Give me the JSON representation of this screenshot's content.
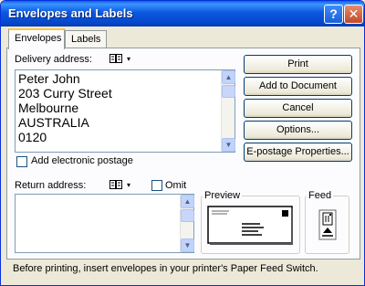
{
  "window": {
    "title": "Envelopes and Labels",
    "help_glyph": "?",
    "close_glyph": "✕"
  },
  "tabs": [
    {
      "label": "Envelopes",
      "active": true
    },
    {
      "label": "Labels",
      "active": false
    }
  ],
  "delivery": {
    "label": "Delivery address:",
    "lines": [
      "Peter John",
      "203 Curry Street",
      "Melbourne",
      "AUSTRALIA",
      "0120"
    ],
    "address_book_icon": "address-book-icon",
    "dropdown_glyph": "▾"
  },
  "postage": {
    "label": "Add electronic postage",
    "checked": false
  },
  "return_address": {
    "label": "Return address:",
    "omit_label": "Omit",
    "omit_checked": false,
    "value": ""
  },
  "buttons": {
    "print": "Print",
    "add_to_document": "Add to Document",
    "cancel": "Cancel",
    "options": "Options...",
    "epostage": "E-postage Properties..."
  },
  "preview": {
    "title": "Preview"
  },
  "feed": {
    "title": "Feed"
  },
  "footer": "Before printing, insert envelopes in your printer's Paper Feed Switch.",
  "colors": {
    "titlebar": "#0b58e1",
    "dialog_bg": "#ece9d8",
    "tab_highlight": "#ffc73c"
  }
}
